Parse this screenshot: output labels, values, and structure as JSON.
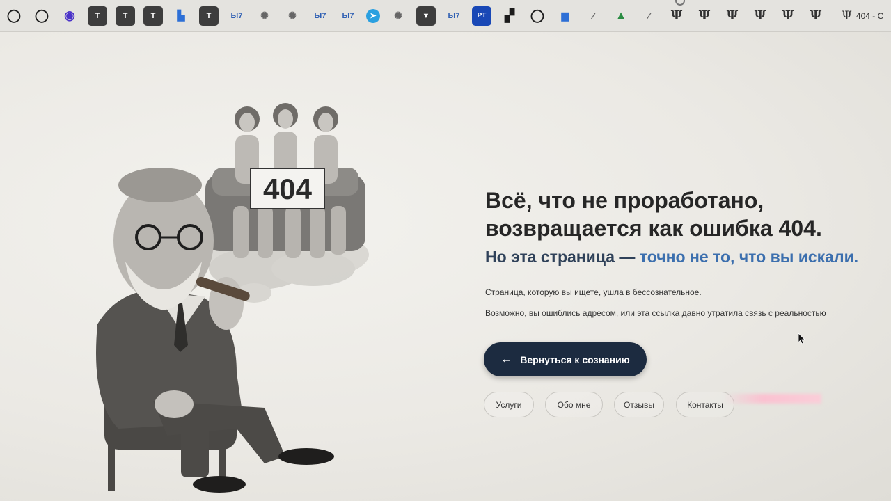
{
  "bookmarks": [
    {
      "name": "bookmark-github-1",
      "glyph": "◯",
      "cls": "gh"
    },
    {
      "name": "bookmark-github-2",
      "glyph": "◯",
      "cls": "gh"
    },
    {
      "name": "bookmark-purple",
      "glyph": "◉",
      "cls": "purple"
    },
    {
      "name": "bookmark-t-1",
      "glyph": "T",
      "cls": "dark"
    },
    {
      "name": "bookmark-t-2",
      "glyph": "T",
      "cls": "dark"
    },
    {
      "name": "bookmark-t-3",
      "glyph": "T",
      "cls": "dark"
    },
    {
      "name": "bookmark-chart-blue",
      "glyph": "▙",
      "cls": "chart"
    },
    {
      "name": "bookmark-t-4",
      "glyph": "T",
      "cls": "dark"
    },
    {
      "name": "bookmark-b17-1",
      "glyph": "Ы7",
      "cls": "blue"
    },
    {
      "name": "bookmark-openai-1",
      "glyph": "✺",
      "cls": "gray"
    },
    {
      "name": "bookmark-openai-2",
      "glyph": "✺",
      "cls": "gray"
    },
    {
      "name": "bookmark-b17-2",
      "glyph": "Ы7",
      "cls": "blue"
    },
    {
      "name": "bookmark-b17-3",
      "glyph": "Ы7",
      "cls": "blue"
    },
    {
      "name": "bookmark-telegram",
      "glyph": "➤",
      "cls": "tg"
    },
    {
      "name": "bookmark-openai-3",
      "glyph": "✺",
      "cls": "gray"
    },
    {
      "name": "bookmark-dark-app",
      "glyph": "▼",
      "cls": "dark"
    },
    {
      "name": "bookmark-b17-4",
      "glyph": "Ы7",
      "cls": "blue"
    },
    {
      "name": "bookmark-pt",
      "glyph": "PT",
      "cls": "pt"
    },
    {
      "name": "bookmark-steps",
      "glyph": "▞",
      "cls": "gh"
    },
    {
      "name": "bookmark-github-3",
      "glyph": "◯",
      "cls": "gh"
    },
    {
      "name": "bookmark-chart",
      "glyph": "▆",
      "cls": "chart"
    },
    {
      "name": "bookmark-light-1",
      "glyph": "⁄",
      "cls": "gray"
    },
    {
      "name": "bookmark-green",
      "glyph": "▲",
      "cls": "green"
    },
    {
      "name": "bookmark-light-2",
      "glyph": "⁄",
      "cls": "gray"
    },
    {
      "name": "bookmark-psi-1",
      "glyph": "Ψ",
      "cls": "psi"
    },
    {
      "name": "bookmark-psi-2",
      "glyph": "Ψ",
      "cls": "psi"
    },
    {
      "name": "bookmark-psi-3",
      "glyph": "Ψ",
      "cls": "psi"
    },
    {
      "name": "bookmark-psi-4",
      "glyph": "Ψ",
      "cls": "psi"
    },
    {
      "name": "bookmark-psi-5",
      "glyph": "Ψ",
      "cls": "psi"
    },
    {
      "name": "bookmark-psi-6",
      "glyph": "Ψ",
      "cls": "psi"
    }
  ],
  "tab": {
    "icon": "Ψ",
    "title": "404 - C"
  },
  "illustration": {
    "sign_text": "404"
  },
  "headline": {
    "line1": "Всё, что не проработано,",
    "line2": "возвращается как ошибка 404."
  },
  "subhead": {
    "part1": "Но эта страница — ",
    "part2": "точно не то, что вы искали."
  },
  "description": {
    "line1": "Страница, которую вы ищете, ушла в бессознательное.",
    "line2": "Возможно, вы ошиблись адресом, или эта ссылка давно утратила связь с реальностью"
  },
  "back_button": {
    "arrow": "←",
    "label": "Вернуться к сознанию"
  },
  "nav": {
    "services": "Услуги",
    "about": "Обо мне",
    "reviews": "Отзывы",
    "contacts": "Контакты"
  },
  "colors": {
    "button_bg": "#1c2b40",
    "subhead": "#2f4159",
    "subhead_accent": "#3c6fae"
  }
}
